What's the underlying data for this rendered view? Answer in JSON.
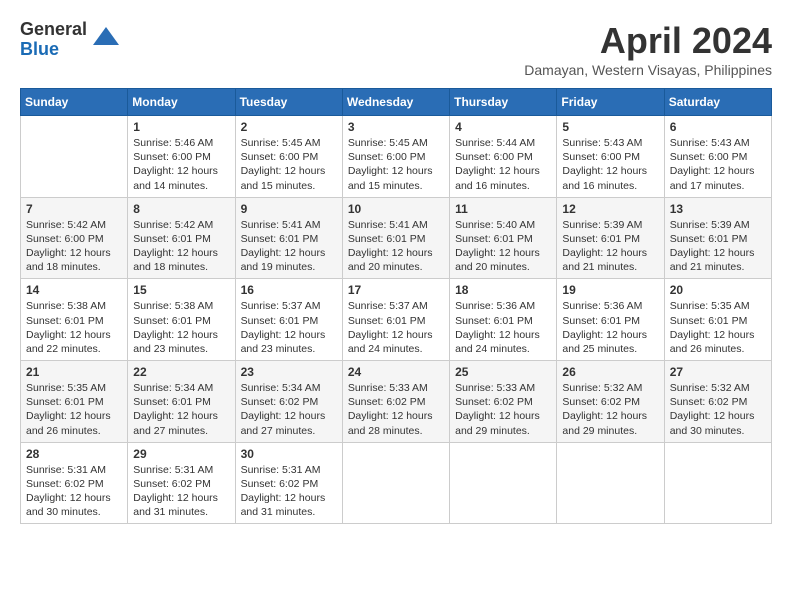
{
  "header": {
    "logo_line1": "General",
    "logo_line2": "Blue",
    "month_year": "April 2024",
    "location": "Damayan, Western Visayas, Philippines"
  },
  "weekdays": [
    "Sunday",
    "Monday",
    "Tuesday",
    "Wednesday",
    "Thursday",
    "Friday",
    "Saturday"
  ],
  "weeks": [
    [
      {
        "day": "",
        "info": ""
      },
      {
        "day": "1",
        "info": "Sunrise: 5:46 AM\nSunset: 6:00 PM\nDaylight: 12 hours\nand 14 minutes."
      },
      {
        "day": "2",
        "info": "Sunrise: 5:45 AM\nSunset: 6:00 PM\nDaylight: 12 hours\nand 15 minutes."
      },
      {
        "day": "3",
        "info": "Sunrise: 5:45 AM\nSunset: 6:00 PM\nDaylight: 12 hours\nand 15 minutes."
      },
      {
        "day": "4",
        "info": "Sunrise: 5:44 AM\nSunset: 6:00 PM\nDaylight: 12 hours\nand 16 minutes."
      },
      {
        "day": "5",
        "info": "Sunrise: 5:43 AM\nSunset: 6:00 PM\nDaylight: 12 hours\nand 16 minutes."
      },
      {
        "day": "6",
        "info": "Sunrise: 5:43 AM\nSunset: 6:00 PM\nDaylight: 12 hours\nand 17 minutes."
      }
    ],
    [
      {
        "day": "7",
        "info": "Sunrise: 5:42 AM\nSunset: 6:00 PM\nDaylight: 12 hours\nand 18 minutes."
      },
      {
        "day": "8",
        "info": "Sunrise: 5:42 AM\nSunset: 6:01 PM\nDaylight: 12 hours\nand 18 minutes."
      },
      {
        "day": "9",
        "info": "Sunrise: 5:41 AM\nSunset: 6:01 PM\nDaylight: 12 hours\nand 19 minutes."
      },
      {
        "day": "10",
        "info": "Sunrise: 5:41 AM\nSunset: 6:01 PM\nDaylight: 12 hours\nand 20 minutes."
      },
      {
        "day": "11",
        "info": "Sunrise: 5:40 AM\nSunset: 6:01 PM\nDaylight: 12 hours\nand 20 minutes."
      },
      {
        "day": "12",
        "info": "Sunrise: 5:39 AM\nSunset: 6:01 PM\nDaylight: 12 hours\nand 21 minutes."
      },
      {
        "day": "13",
        "info": "Sunrise: 5:39 AM\nSunset: 6:01 PM\nDaylight: 12 hours\nand 21 minutes."
      }
    ],
    [
      {
        "day": "14",
        "info": "Sunrise: 5:38 AM\nSunset: 6:01 PM\nDaylight: 12 hours\nand 22 minutes."
      },
      {
        "day": "15",
        "info": "Sunrise: 5:38 AM\nSunset: 6:01 PM\nDaylight: 12 hours\nand 23 minutes."
      },
      {
        "day": "16",
        "info": "Sunrise: 5:37 AM\nSunset: 6:01 PM\nDaylight: 12 hours\nand 23 minutes."
      },
      {
        "day": "17",
        "info": "Sunrise: 5:37 AM\nSunset: 6:01 PM\nDaylight: 12 hours\nand 24 minutes."
      },
      {
        "day": "18",
        "info": "Sunrise: 5:36 AM\nSunset: 6:01 PM\nDaylight: 12 hours\nand 24 minutes."
      },
      {
        "day": "19",
        "info": "Sunrise: 5:36 AM\nSunset: 6:01 PM\nDaylight: 12 hours\nand 25 minutes."
      },
      {
        "day": "20",
        "info": "Sunrise: 5:35 AM\nSunset: 6:01 PM\nDaylight: 12 hours\nand 26 minutes."
      }
    ],
    [
      {
        "day": "21",
        "info": "Sunrise: 5:35 AM\nSunset: 6:01 PM\nDaylight: 12 hours\nand 26 minutes."
      },
      {
        "day": "22",
        "info": "Sunrise: 5:34 AM\nSunset: 6:01 PM\nDaylight: 12 hours\nand 27 minutes."
      },
      {
        "day": "23",
        "info": "Sunrise: 5:34 AM\nSunset: 6:02 PM\nDaylight: 12 hours\nand 27 minutes."
      },
      {
        "day": "24",
        "info": "Sunrise: 5:33 AM\nSunset: 6:02 PM\nDaylight: 12 hours\nand 28 minutes."
      },
      {
        "day": "25",
        "info": "Sunrise: 5:33 AM\nSunset: 6:02 PM\nDaylight: 12 hours\nand 29 minutes."
      },
      {
        "day": "26",
        "info": "Sunrise: 5:32 AM\nSunset: 6:02 PM\nDaylight: 12 hours\nand 29 minutes."
      },
      {
        "day": "27",
        "info": "Sunrise: 5:32 AM\nSunset: 6:02 PM\nDaylight: 12 hours\nand 30 minutes."
      }
    ],
    [
      {
        "day": "28",
        "info": "Sunrise: 5:31 AM\nSunset: 6:02 PM\nDaylight: 12 hours\nand 30 minutes."
      },
      {
        "day": "29",
        "info": "Sunrise: 5:31 AM\nSunset: 6:02 PM\nDaylight: 12 hours\nand 31 minutes."
      },
      {
        "day": "30",
        "info": "Sunrise: 5:31 AM\nSunset: 6:02 PM\nDaylight: 12 hours\nand 31 minutes."
      },
      {
        "day": "",
        "info": ""
      },
      {
        "day": "",
        "info": ""
      },
      {
        "day": "",
        "info": ""
      },
      {
        "day": "",
        "info": ""
      }
    ]
  ]
}
